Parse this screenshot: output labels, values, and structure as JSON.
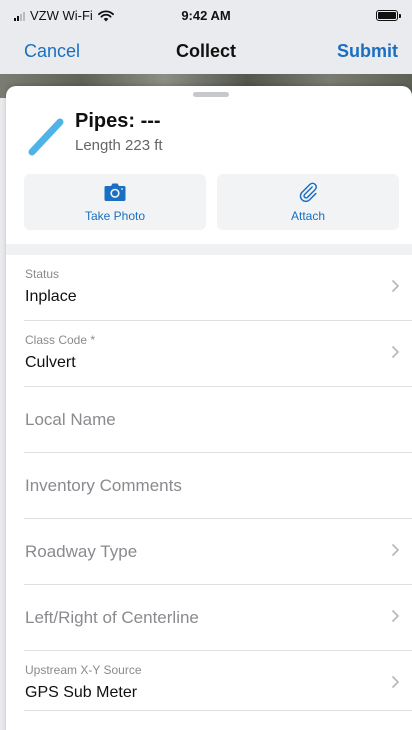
{
  "status_bar": {
    "carrier": "VZW Wi-Fi",
    "time": "9:42 AM"
  },
  "nav": {
    "cancel": "Cancel",
    "title": "Collect",
    "submit": "Submit"
  },
  "feature": {
    "title": "Pipes: ---",
    "subtitle": "Length 223 ft",
    "icon": "pipe-line-icon"
  },
  "actions": {
    "photo_label": "Take Photo",
    "attach_label": "Attach"
  },
  "colors": {
    "accent": "#1a6fc1",
    "pipe_icon": "#4fb3e8"
  },
  "fields": [
    {
      "label": "Status",
      "value": "Inplace",
      "chevron": true
    },
    {
      "label": "Class Code *",
      "value": "Culvert",
      "chevron": true
    },
    {
      "placeholder": "Local Name",
      "chevron": false
    },
    {
      "placeholder": "Inventory Comments",
      "chevron": false
    },
    {
      "placeholder": "Roadway Type",
      "chevron": true
    },
    {
      "placeholder": "Left/Right of Centerline",
      "chevron": true
    },
    {
      "label": "Upstream X-Y Source",
      "value": "GPS Sub Meter",
      "chevron": true
    }
  ]
}
